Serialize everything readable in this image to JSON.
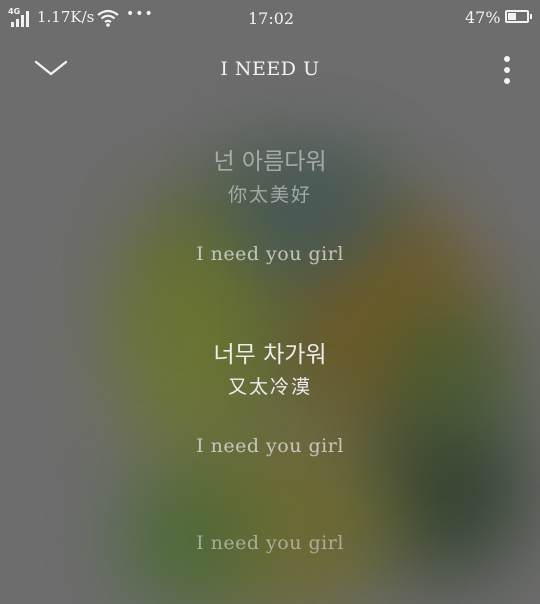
{
  "status_bar": {
    "network_type": "4G",
    "net_speed": "1.17K/s",
    "more_indicator": "•••",
    "time": "17:02",
    "battery_percent": "47%",
    "battery_level": 0.47
  },
  "header": {
    "title": "I NEED U",
    "back_icon": "chevron-down-icon",
    "menu_icon": "more-vertical-icon"
  },
  "lyrics": [
    {
      "korean": "넌 아름다워",
      "chinese": "你太美好"
    },
    {
      "english": "I need you girl"
    },
    {
      "korean": "너무 차가워",
      "chinese": "又太冷漠"
    },
    {
      "english": "I need you girl"
    },
    {
      "english": "I need you girl"
    }
  ]
}
